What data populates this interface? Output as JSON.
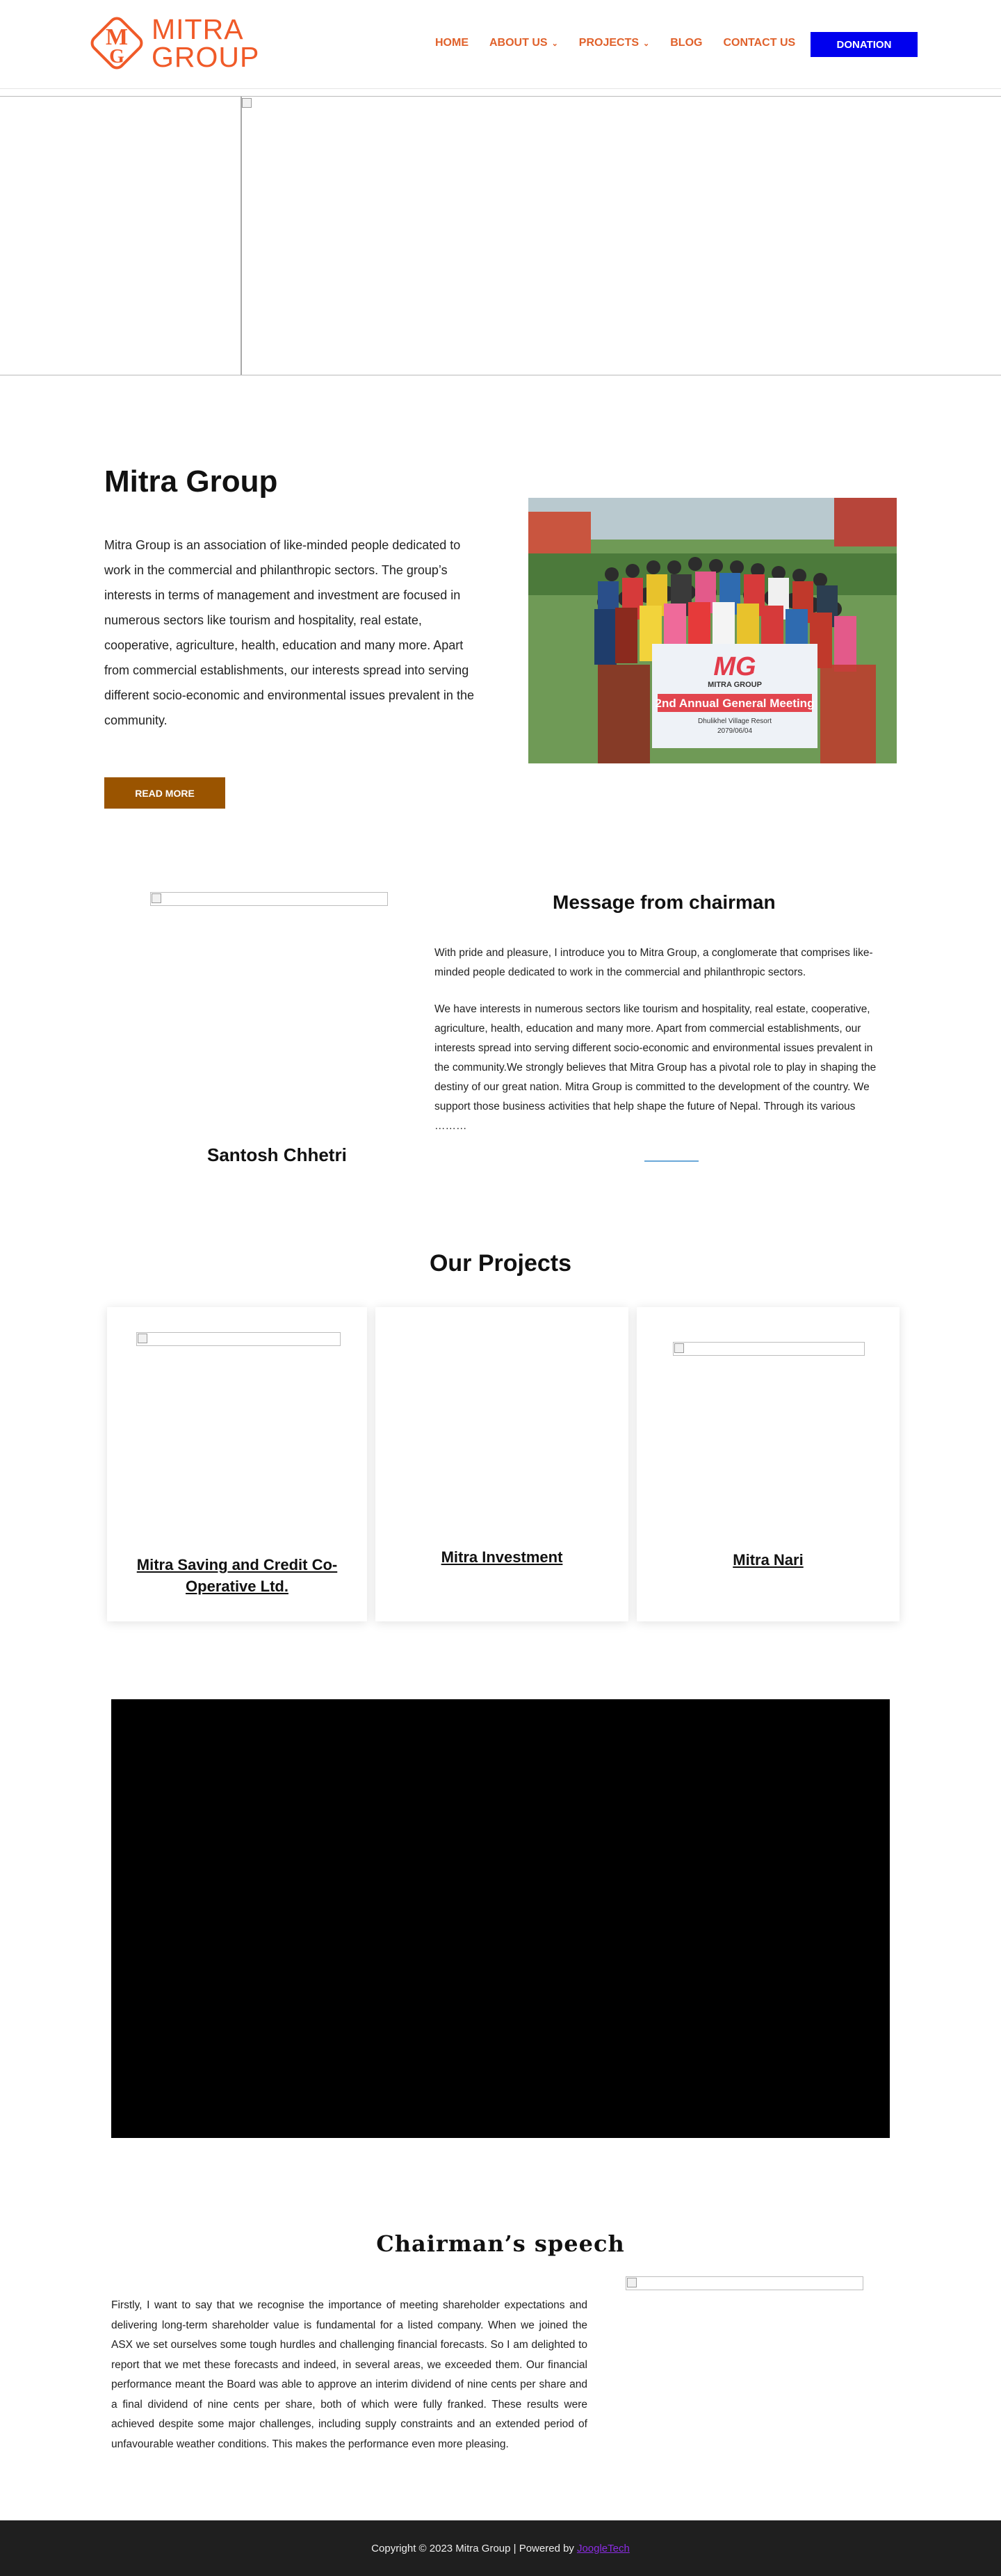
{
  "header": {
    "logo_line1": "MITRA",
    "logo_line2": "GROUP",
    "nav": [
      {
        "label": "HOME",
        "has_dropdown": false
      },
      {
        "label": "ABOUT US",
        "has_dropdown": true
      },
      {
        "label": "PROJECTS",
        "has_dropdown": true
      },
      {
        "label": "BLOG",
        "has_dropdown": false
      },
      {
        "label": "CONTACT US",
        "has_dropdown": false
      }
    ],
    "donate_label": "DONATION"
  },
  "about": {
    "title": "Mitra Group",
    "text": "Mitra Group is an association of like-minded people dedicated to work in the commercial and philanthropic sectors. The group’s interests in terms of management and investment are focused in numerous sectors like tourism and hospitality, real estate, cooperative, agriculture, health, education and many more. Apart from commercial establishments, our interests spread into serving different socio-economic and environmental issues prevalent in the community.",
    "read_more": "READ MORE",
    "photo_banner_logo": "MG",
    "photo_banner_name": "MITRA GROUP",
    "photo_banner_event": "2nd Annual General Meeting",
    "photo_banner_venue": "Dhulikhel Village Resort",
    "photo_banner_date": "2079/06/04"
  },
  "chairman": {
    "name": "Santosh Chhetri",
    "title": "Message from chairman",
    "p1": "With pride and pleasure, I introduce you to Mitra Group, a conglomerate that comprises like-minded people dedicated to work in the commercial and philanthropic sectors.",
    "p2": "We have interests in numerous sectors like tourism and hospitality, real estate, cooperative, agriculture, health, education and many more. Apart from commercial establishments, our interests spread into serving different socio-economic and environmental issues prevalent in the community.We strongly believes that Mitra Group has a pivotal role to play in shaping the destiny of our great nation. Mitra Group is committed to the development of the country. We support those business activities that help shape the future of Nepal. Through its various ………"
  },
  "projects": {
    "title": "Our Projects",
    "items": [
      {
        "label": "Mitra Saving and Credit Co-Operative Ltd."
      },
      {
        "label": "Mitra Investment"
      },
      {
        "label": "Mitra Nari"
      }
    ]
  },
  "speech": {
    "title": "Chairman’s speech",
    "text": "Firstly, I want to say that we recognise the importance of meeting shareholder expectations and delivering long-term shareholder value is fundamental for a listed company. When we joined the ASX we set ourselves some tough hurdles and challenging financial forecasts. So I am delighted to report that we met these forecasts and indeed, in several areas, we exceeded them. Our financial performance meant the Board was able to approve an interim dividend of nine cents per share and a final dividend of nine cents per share, both of which were fully franked. These results were achieved despite some major challenges, including supply constraints and an extended period of unfavourable weather conditions. This makes the performance even more pleasing."
  },
  "footer": {
    "text": "Copyright © 2023 Mitra Group | Powered by",
    "link": "JoogleTech"
  },
  "colors": {
    "brand_orange": "#f05a28",
    "nav_orange": "#e0612b",
    "donate_blue": "#0000ee",
    "read_more_brown": "#9a5400",
    "footer_bg": "#1f1f1f",
    "footer_link": "#8a2be2"
  }
}
